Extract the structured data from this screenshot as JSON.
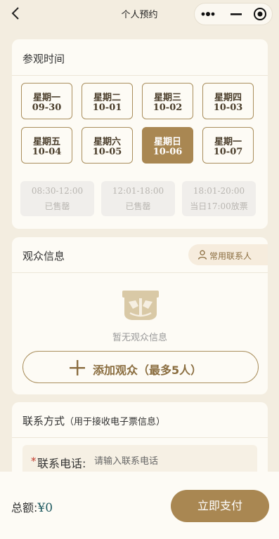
{
  "header": {
    "title": "个人预约"
  },
  "visit_time": {
    "title": "参观时间",
    "dates": [
      {
        "weekday": "星期一",
        "date": "09-30",
        "selected": false
      },
      {
        "weekday": "星期二",
        "date": "10-01",
        "selected": false
      },
      {
        "weekday": "星期三",
        "date": "10-02",
        "selected": false
      },
      {
        "weekday": "星期四",
        "date": "10-03",
        "selected": false
      },
      {
        "weekday": "星期五",
        "date": "10-04",
        "selected": false
      },
      {
        "weekday": "星期六",
        "date": "10-05",
        "selected": false
      },
      {
        "weekday": "星期日",
        "date": "10-06",
        "selected": true
      },
      {
        "weekday": "星期一",
        "date": "10-07",
        "selected": false
      }
    ],
    "slots": [
      {
        "time": "08:30-12:00",
        "status": "已售罄"
      },
      {
        "time": "12:01-18:00",
        "status": "已售罄"
      },
      {
        "time": "18:01-20:00",
        "status": "当日17:00放票"
      }
    ]
  },
  "visitors": {
    "title": "观众信息",
    "contacts_label": "常用联系人",
    "empty_text": "暂无观众信息",
    "add_label": "添加观众（最多5人）"
  },
  "contact": {
    "title": "联系方式",
    "title_note": "（用于接收电子票信息）",
    "required_mark": "*",
    "phone_label": "联系电话:",
    "phone_placeholder": "请输入联系电话",
    "phone_value": ""
  },
  "footer": {
    "total_label": "总额:",
    "total_amount": "¥0",
    "pay_label": "立即支付"
  },
  "colors": {
    "accent": "#a98752",
    "background": "#f3ede0",
    "card": "#fdfbf5",
    "required": "#c0392b",
    "amount": "#1f5a60"
  }
}
